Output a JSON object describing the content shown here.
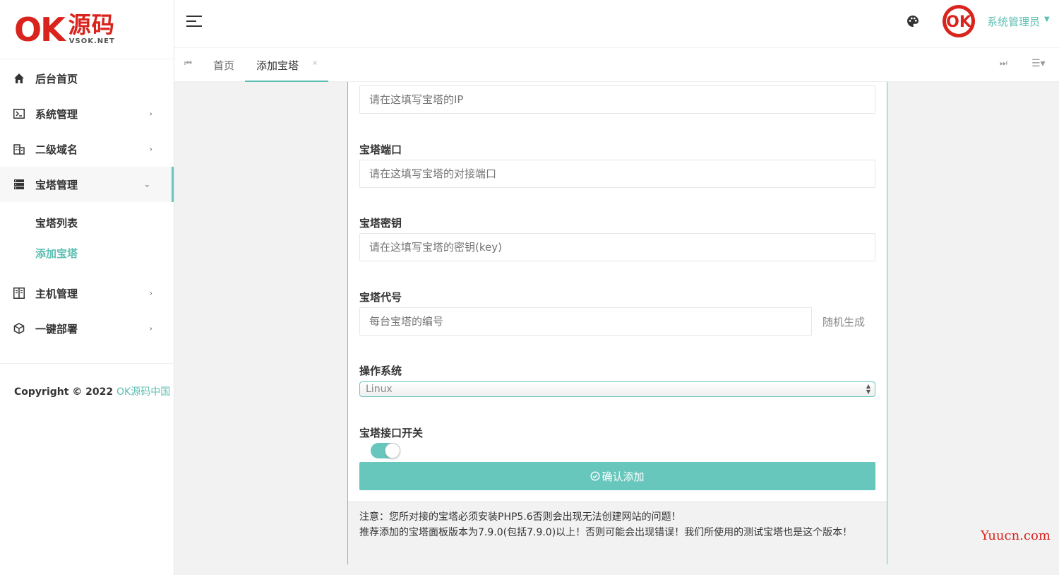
{
  "logo": {
    "mark": "OK",
    "cn": "源码",
    "en": "VSOK.NET"
  },
  "sidebar": {
    "items": [
      {
        "label": "后台首页",
        "icon": "home-icon",
        "has_children": false
      },
      {
        "label": "系统管理",
        "icon": "terminal-icon",
        "has_children": true
      },
      {
        "label": "二级域名",
        "icon": "building-icon",
        "has_children": true
      },
      {
        "label": "宝塔管理",
        "icon": "server-icon",
        "has_children": true,
        "open": true
      },
      {
        "label": "主机管理",
        "icon": "columns-icon",
        "has_children": true
      },
      {
        "label": "一键部署",
        "icon": "cube-icon",
        "has_children": true
      }
    ],
    "sub_items": [
      {
        "label": "宝塔列表",
        "active": false
      },
      {
        "label": "添加宝塔",
        "active": true
      }
    ],
    "copyright_prefix": "Copyright © 2022 ",
    "copyright_brand": "OK源码中国"
  },
  "header": {
    "user_name": "系统管理员",
    "avatar_text": "OK"
  },
  "tabs": {
    "home": "首页",
    "active": "添加宝塔",
    "close_glyph": "×"
  },
  "form": {
    "ip_placeholder": "请在这填写宝塔的IP",
    "port_label": "宝塔端口",
    "port_placeholder": "请在这填写宝塔的对接端口",
    "key_label": "宝塔密钥",
    "key_placeholder": "请在这填写宝塔的密钥(key)",
    "code_label": "宝塔代号",
    "code_placeholder": "每台宝塔的编号",
    "code_addon": "随机生成",
    "os_label": "操作系统",
    "os_selected": "Linux",
    "switch_label": "宝塔接口开关",
    "switch_on": true,
    "submit_label": "确认添加",
    "notice_line1": "注意：您所对接的宝塔必须安装PHP5.6否则会出现无法创建网站的问题！",
    "notice_line2": "推荐添加的宝塔面板版本为7.9.0(包括7.9.0)以上！否则可能会出现错误！我们所使用的测试宝塔也是这个版本！"
  },
  "watermark": "Yuucn.com",
  "colors": {
    "accent": "#67c7bc",
    "brand_red": "#d9231d"
  }
}
